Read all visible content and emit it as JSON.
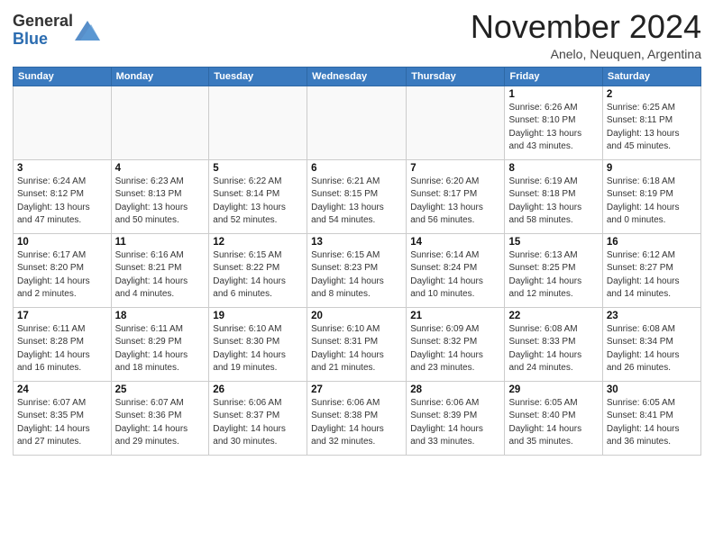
{
  "header": {
    "logo_line1": "General",
    "logo_line2": "Blue",
    "month_title": "November 2024",
    "location": "Anelo, Neuquen, Argentina"
  },
  "weekdays": [
    "Sunday",
    "Monday",
    "Tuesday",
    "Wednesday",
    "Thursday",
    "Friday",
    "Saturday"
  ],
  "weeks": [
    [
      {
        "day": "",
        "info": ""
      },
      {
        "day": "",
        "info": ""
      },
      {
        "day": "",
        "info": ""
      },
      {
        "day": "",
        "info": ""
      },
      {
        "day": "",
        "info": ""
      },
      {
        "day": "1",
        "info": "Sunrise: 6:26 AM\nSunset: 8:10 PM\nDaylight: 13 hours\nand 43 minutes."
      },
      {
        "day": "2",
        "info": "Sunrise: 6:25 AM\nSunset: 8:11 PM\nDaylight: 13 hours\nand 45 minutes."
      }
    ],
    [
      {
        "day": "3",
        "info": "Sunrise: 6:24 AM\nSunset: 8:12 PM\nDaylight: 13 hours\nand 47 minutes."
      },
      {
        "day": "4",
        "info": "Sunrise: 6:23 AM\nSunset: 8:13 PM\nDaylight: 13 hours\nand 50 minutes."
      },
      {
        "day": "5",
        "info": "Sunrise: 6:22 AM\nSunset: 8:14 PM\nDaylight: 13 hours\nand 52 minutes."
      },
      {
        "day": "6",
        "info": "Sunrise: 6:21 AM\nSunset: 8:15 PM\nDaylight: 13 hours\nand 54 minutes."
      },
      {
        "day": "7",
        "info": "Sunrise: 6:20 AM\nSunset: 8:17 PM\nDaylight: 13 hours\nand 56 minutes."
      },
      {
        "day": "8",
        "info": "Sunrise: 6:19 AM\nSunset: 8:18 PM\nDaylight: 13 hours\nand 58 minutes."
      },
      {
        "day": "9",
        "info": "Sunrise: 6:18 AM\nSunset: 8:19 PM\nDaylight: 14 hours\nand 0 minutes."
      }
    ],
    [
      {
        "day": "10",
        "info": "Sunrise: 6:17 AM\nSunset: 8:20 PM\nDaylight: 14 hours\nand 2 minutes."
      },
      {
        "day": "11",
        "info": "Sunrise: 6:16 AM\nSunset: 8:21 PM\nDaylight: 14 hours\nand 4 minutes."
      },
      {
        "day": "12",
        "info": "Sunrise: 6:15 AM\nSunset: 8:22 PM\nDaylight: 14 hours\nand 6 minutes."
      },
      {
        "day": "13",
        "info": "Sunrise: 6:15 AM\nSunset: 8:23 PM\nDaylight: 14 hours\nand 8 minutes."
      },
      {
        "day": "14",
        "info": "Sunrise: 6:14 AM\nSunset: 8:24 PM\nDaylight: 14 hours\nand 10 minutes."
      },
      {
        "day": "15",
        "info": "Sunrise: 6:13 AM\nSunset: 8:25 PM\nDaylight: 14 hours\nand 12 minutes."
      },
      {
        "day": "16",
        "info": "Sunrise: 6:12 AM\nSunset: 8:27 PM\nDaylight: 14 hours\nand 14 minutes."
      }
    ],
    [
      {
        "day": "17",
        "info": "Sunrise: 6:11 AM\nSunset: 8:28 PM\nDaylight: 14 hours\nand 16 minutes."
      },
      {
        "day": "18",
        "info": "Sunrise: 6:11 AM\nSunset: 8:29 PM\nDaylight: 14 hours\nand 18 minutes."
      },
      {
        "day": "19",
        "info": "Sunrise: 6:10 AM\nSunset: 8:30 PM\nDaylight: 14 hours\nand 19 minutes."
      },
      {
        "day": "20",
        "info": "Sunrise: 6:10 AM\nSunset: 8:31 PM\nDaylight: 14 hours\nand 21 minutes."
      },
      {
        "day": "21",
        "info": "Sunrise: 6:09 AM\nSunset: 8:32 PM\nDaylight: 14 hours\nand 23 minutes."
      },
      {
        "day": "22",
        "info": "Sunrise: 6:08 AM\nSunset: 8:33 PM\nDaylight: 14 hours\nand 24 minutes."
      },
      {
        "day": "23",
        "info": "Sunrise: 6:08 AM\nSunset: 8:34 PM\nDaylight: 14 hours\nand 26 minutes."
      }
    ],
    [
      {
        "day": "24",
        "info": "Sunrise: 6:07 AM\nSunset: 8:35 PM\nDaylight: 14 hours\nand 27 minutes."
      },
      {
        "day": "25",
        "info": "Sunrise: 6:07 AM\nSunset: 8:36 PM\nDaylight: 14 hours\nand 29 minutes."
      },
      {
        "day": "26",
        "info": "Sunrise: 6:06 AM\nSunset: 8:37 PM\nDaylight: 14 hours\nand 30 minutes."
      },
      {
        "day": "27",
        "info": "Sunrise: 6:06 AM\nSunset: 8:38 PM\nDaylight: 14 hours\nand 32 minutes."
      },
      {
        "day": "28",
        "info": "Sunrise: 6:06 AM\nSunset: 8:39 PM\nDaylight: 14 hours\nand 33 minutes."
      },
      {
        "day": "29",
        "info": "Sunrise: 6:05 AM\nSunset: 8:40 PM\nDaylight: 14 hours\nand 35 minutes."
      },
      {
        "day": "30",
        "info": "Sunrise: 6:05 AM\nSunset: 8:41 PM\nDaylight: 14 hours\nand 36 minutes."
      }
    ]
  ]
}
